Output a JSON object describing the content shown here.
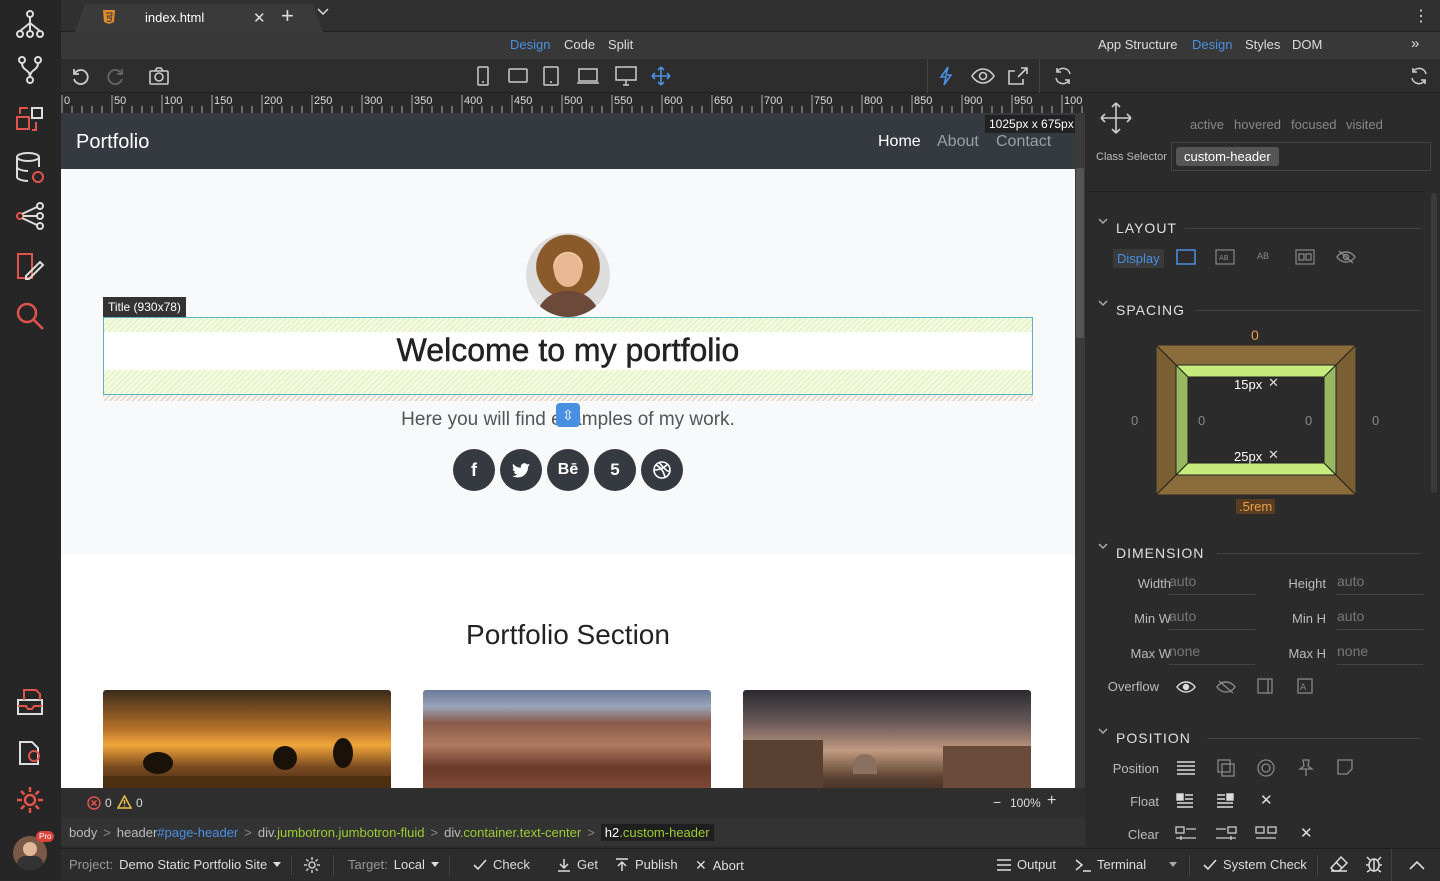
{
  "tab": {
    "title": "index.html"
  },
  "view_modes": {
    "design": "Design",
    "code": "Code",
    "split": "Split"
  },
  "panel_tabs": {
    "app_structure": "App Structure",
    "design": "Design",
    "styles": "Styles",
    "dom": "DOM"
  },
  "ruler": {
    "labels": [
      "0",
      "50",
      "100",
      "150",
      "200",
      "250",
      "300",
      "350",
      "400",
      "450",
      "500",
      "550",
      "600",
      "650",
      "700",
      "750",
      "800",
      "850",
      "900",
      "950",
      "100"
    ]
  },
  "canvas": {
    "size_badge": "1025px x 675px",
    "nav": {
      "brand": "Portfolio",
      "links": [
        "Home",
        "About",
        "Contact"
      ]
    },
    "selection_label": "Title (930x78)",
    "hero_title": "Welcome to my portfolio",
    "hero_subtitle": "Here you will find examples of my work.",
    "social": [
      "facebook",
      "twitter",
      "behance",
      "500px",
      "dribbble"
    ],
    "section_title": "Portfolio Section"
  },
  "status": {
    "errors": "0",
    "warnings": "0",
    "zoom": "100%"
  },
  "breadcrumb": [
    {
      "tag": "body",
      "extra": ""
    },
    {
      "tag": "header",
      "extra": "#page-header"
    },
    {
      "tag": "div",
      "extra": ".jumbotron.jumbotron-fluid"
    },
    {
      "tag": "div",
      "extra": ".container.text-center"
    },
    {
      "tag": "h2",
      "extra": ".custom-header"
    }
  ],
  "bottom": {
    "project_label": "Project:",
    "project_name": "Demo Static Portfolio Site",
    "target_label": "Target:",
    "target_value": "Local",
    "check": "Check",
    "get": "Get",
    "publish": "Publish",
    "abort": "Abort",
    "output": "Output",
    "terminal": "Terminal",
    "system_check": "System Check"
  },
  "inspector": {
    "states": [
      "active",
      "hovered",
      "focused",
      "visited"
    ],
    "class_selector_label": "Class Selector",
    "class_chip": "custom-header",
    "layout_title": "LAYOUT",
    "display_label": "Display",
    "spacing_title": "SPACING",
    "spacing": {
      "margin_top": "0",
      "margin_left": "0",
      "margin_right": "0",
      "padding_top": "15px",
      "padding_bottom": "25px",
      "padding_left": "0",
      "padding_right": "0",
      "margin_bottom": ".5rem"
    },
    "dimension_title": "DIMENSION",
    "width_label": "Width",
    "width_value": "auto",
    "height_label": "Height",
    "height_value": "auto",
    "minw_label": "Min W",
    "minw_value": "auto",
    "minh_label": "Min H",
    "minh_value": "auto",
    "maxw_label": "Max W",
    "maxw_value": "none",
    "maxh_label": "Max H",
    "maxh_value": "none",
    "overflow_label": "Overflow",
    "position_title": "POSITION",
    "position_label": "Position",
    "float_label": "Float",
    "clear_label": "Clear"
  },
  "colors": {
    "accent": "#4a90e2",
    "selection": "#5bb5c9",
    "padding": "#c7ea7c",
    "margin": "#8a6d3b",
    "crumb_class": "#9acd32"
  }
}
